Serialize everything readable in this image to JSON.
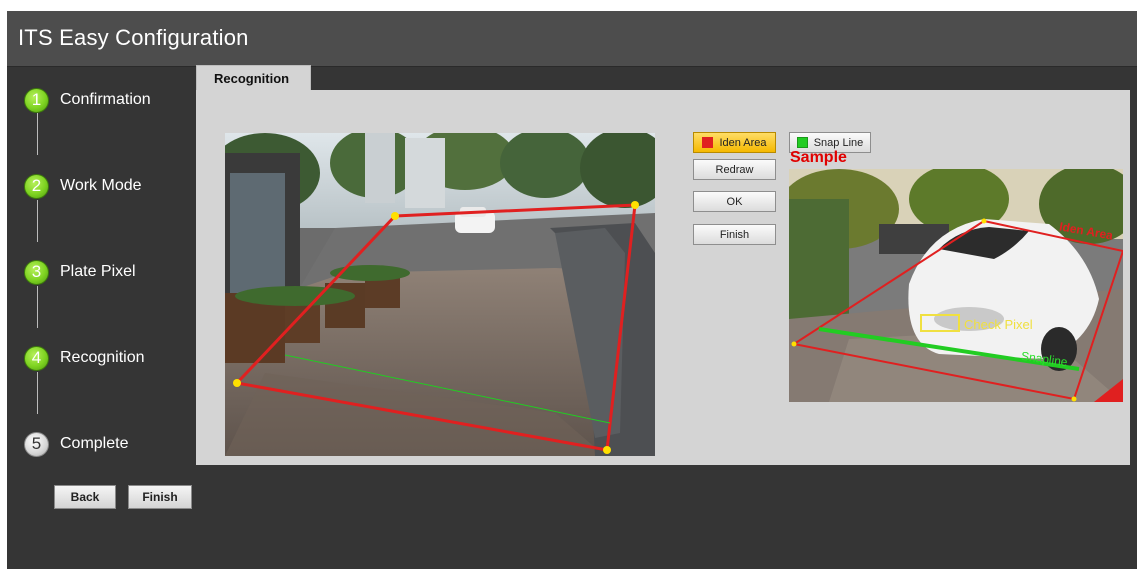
{
  "window": {
    "title": "ITS Easy Configuration"
  },
  "steps": [
    {
      "num": "1",
      "label": "Confirmation",
      "state": "done"
    },
    {
      "num": "2",
      "label": "Work Mode",
      "state": "done"
    },
    {
      "num": "3",
      "label": "Plate Pixel",
      "state": "done"
    },
    {
      "num": "4",
      "label": "Recognition",
      "state": "done"
    },
    {
      "num": "5",
      "label": "Complete",
      "state": "pending"
    }
  ],
  "nav": {
    "back_label": "Back",
    "finish_label": "Finish"
  },
  "tab": {
    "label": "Recognition"
  },
  "controls": {
    "iden_area_label": "Iden Area",
    "iden_area_color": "#e02020",
    "snap_line_label": "Snap Line",
    "snap_line_color": "#22cc22",
    "redraw_label": "Redraw",
    "ok_label": "OK",
    "finish_label": "Finish"
  },
  "sample": {
    "label": "Sample",
    "check_pixel_label": "Check Pixel",
    "snapline_label": "Snapline",
    "iden_area_label": "Iden Area"
  },
  "colors": {
    "accent_green": "#7ed321",
    "active_button": "#f5b800",
    "iden_area": "#e02020",
    "snap_line": "#22cc22",
    "handle": "#ffe000"
  }
}
